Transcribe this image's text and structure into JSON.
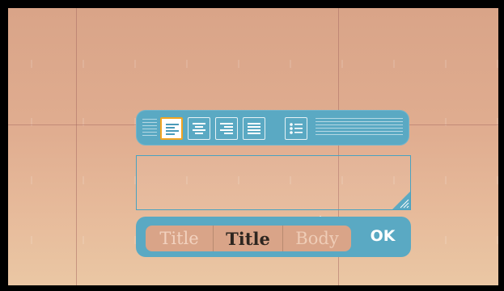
{
  "toolbar": {
    "buttons": [
      {
        "name": "align-left",
        "icon": "align-left-icon",
        "active": true
      },
      {
        "name": "align-center",
        "icon": "align-center-icon",
        "active": false
      },
      {
        "name": "align-right",
        "icon": "align-right-icon",
        "active": false
      },
      {
        "name": "align-justify",
        "icon": "align-justify-icon",
        "active": false
      },
      {
        "name": "bullet-list",
        "icon": "bullet-list-icon",
        "active": false
      }
    ]
  },
  "textbox": {
    "value": ""
  },
  "text_styles": [
    {
      "label": "Title",
      "selected": false
    },
    {
      "label": "Title",
      "selected": true
    },
    {
      "label": "Body",
      "selected": false
    }
  ],
  "ok_label": "OK",
  "colors": {
    "panel": "#5aa9c3",
    "active_border": "#f3a520",
    "background_top": "#d9a488",
    "background_bottom": "#eac7a4"
  }
}
